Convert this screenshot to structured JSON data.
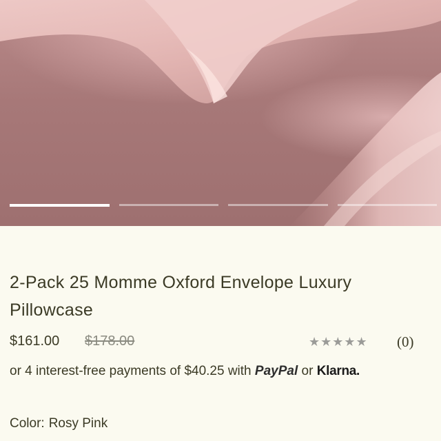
{
  "product": {
    "title": "2-Pack 25 Momme Oxford Envelope Luxury Pillowcase",
    "price": "$161.00",
    "compare_price": "$178.00",
    "rating_stars": "★★★★★",
    "review_count": "(0)",
    "installments": {
      "prefix": "or 4 interest-free payments of $40.25 with",
      "paypal": "PayPal",
      "or": "or",
      "klarna": "Klarna."
    },
    "color_label": "Color:",
    "color_value": "Rosy Pink"
  },
  "carousel": {
    "slides": 4,
    "active_index": 0
  },
  "colors": {
    "background": "#fbfaf0",
    "text": "#3b3a25",
    "silk": "#b98a8a",
    "star": "#9b9b98"
  }
}
